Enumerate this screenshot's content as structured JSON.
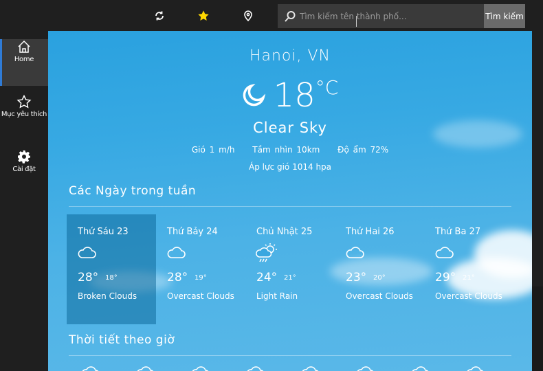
{
  "topbar": {
    "refresh_icon": "refresh-icon",
    "favorite_icon": "star-icon",
    "location_icon": "map-pin-icon",
    "search_placeholder": "Tìm kiếm tên thành phố...",
    "search_button": "Tìm kiếm"
  },
  "sidebar": {
    "items": [
      {
        "label": "Home",
        "icon": "home-icon",
        "active": true
      },
      {
        "label": "Mục yêu thích",
        "icon": "star-outline-icon",
        "active": false
      },
      {
        "label": "Cài đặt",
        "icon": "gear-icon",
        "active": false
      }
    ]
  },
  "current": {
    "city": "Hanoi, VN",
    "temperature": "18",
    "unit": "°C",
    "icon": "crescent-moon-icon",
    "condition": "Clear Sky",
    "wind": "Gió 1 m/h",
    "visibility": "Tầm nhìn 10km",
    "humidity": "Độ ẩm 72%",
    "pressure": "Áp lực gió 1014 hpa"
  },
  "weekly": {
    "title": "Các Ngày trong tuần",
    "days": [
      {
        "name": "Thứ Sáu 23",
        "hi": "28°",
        "lo": "18°",
        "desc": "Broken Clouds",
        "icon": "cloud-icon"
      },
      {
        "name": "Thứ Bảy 24",
        "hi": "28°",
        "lo": "19°",
        "desc": "Overcast Clouds",
        "icon": "cloud-icon"
      },
      {
        "name": "Chủ Nhật 25",
        "hi": "24°",
        "lo": "21°",
        "desc": "Light Rain",
        "icon": "sun-rain-cloud-icon"
      },
      {
        "name": "Thứ Hai 26",
        "hi": "23°",
        "lo": "20°",
        "desc": "Overcast Clouds",
        "icon": "cloud-icon"
      },
      {
        "name": "Thứ Ba 27",
        "hi": "29°",
        "lo": "21°",
        "desc": "Overcast Clouds",
        "icon": "cloud-icon"
      }
    ]
  },
  "hourly": {
    "title": "Thời tiết theo giờ"
  },
  "colors": {
    "sky": "#3aaae3",
    "sidebar_bg": "#1f1f1f",
    "active_indicator": "#2f7bd6",
    "selected_day": "#1a7fb0",
    "star": "#ffd800"
  }
}
